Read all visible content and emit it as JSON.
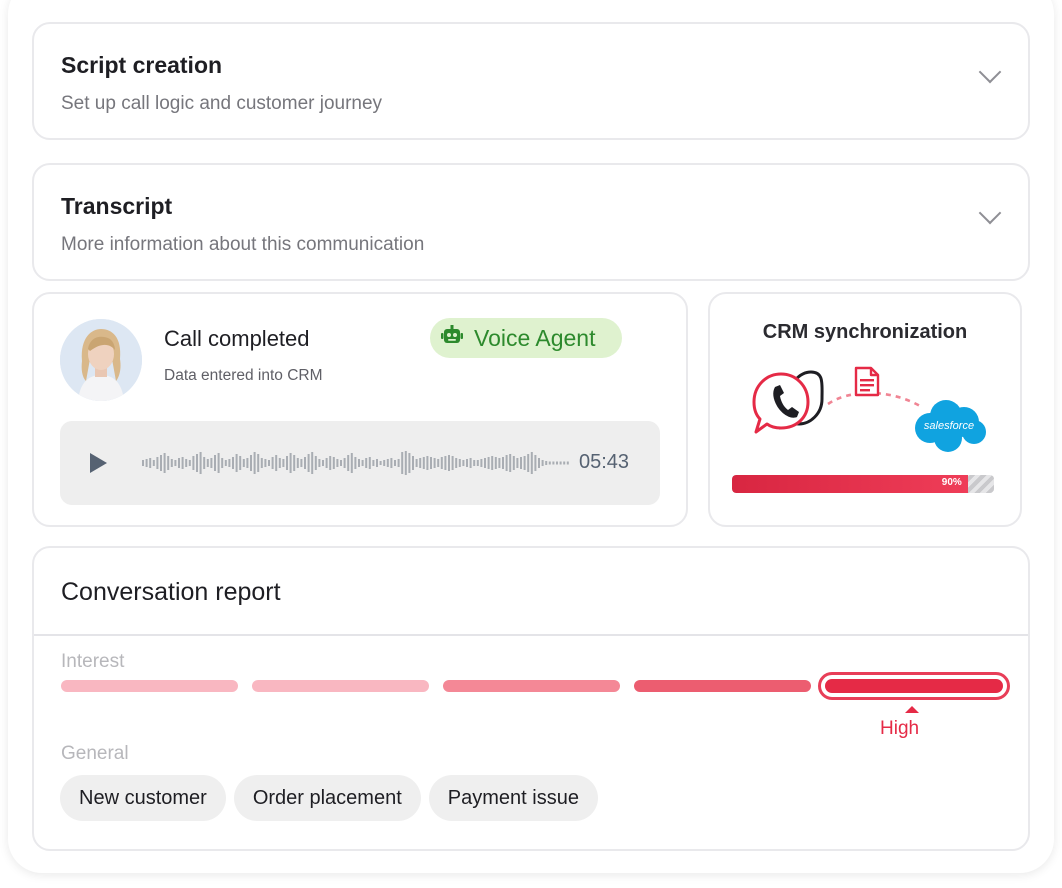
{
  "sections": {
    "script": {
      "title": "Script creation",
      "subtitle": "Set up call logic and customer journey"
    },
    "transcript": {
      "title": "Transcript",
      "subtitle": "More information about this communication"
    }
  },
  "call": {
    "title": "Call completed",
    "subtitle": "Data entered into CRM",
    "badge": "Voice Agent",
    "duration": "05:43"
  },
  "crm": {
    "title": "CRM synchronization",
    "logo_text": "salesforce",
    "progress": 90,
    "progress_label": "90%"
  },
  "report": {
    "title": "Conversation report",
    "interest_label": "Interest",
    "level_label": "High",
    "level_index": 4,
    "general_label": "General",
    "tags": [
      "New customer",
      "Order placement",
      "Payment issue"
    ]
  },
  "colors": {
    "accent": "#e52a46",
    "badge_bg": "#dff2cf",
    "badge_text": "#2d8a2d",
    "segments": [
      "#f9b7c1",
      "#f9b7c1",
      "#f48896",
      "#ec5d70",
      "#e52a46"
    ]
  },
  "icons": {
    "chevron": "chevron-down-icon",
    "robot": "robot-icon",
    "play": "play-icon",
    "phone": "phone-chat-icon",
    "document": "document-icon",
    "cloud": "salesforce-cloud-icon"
  }
}
